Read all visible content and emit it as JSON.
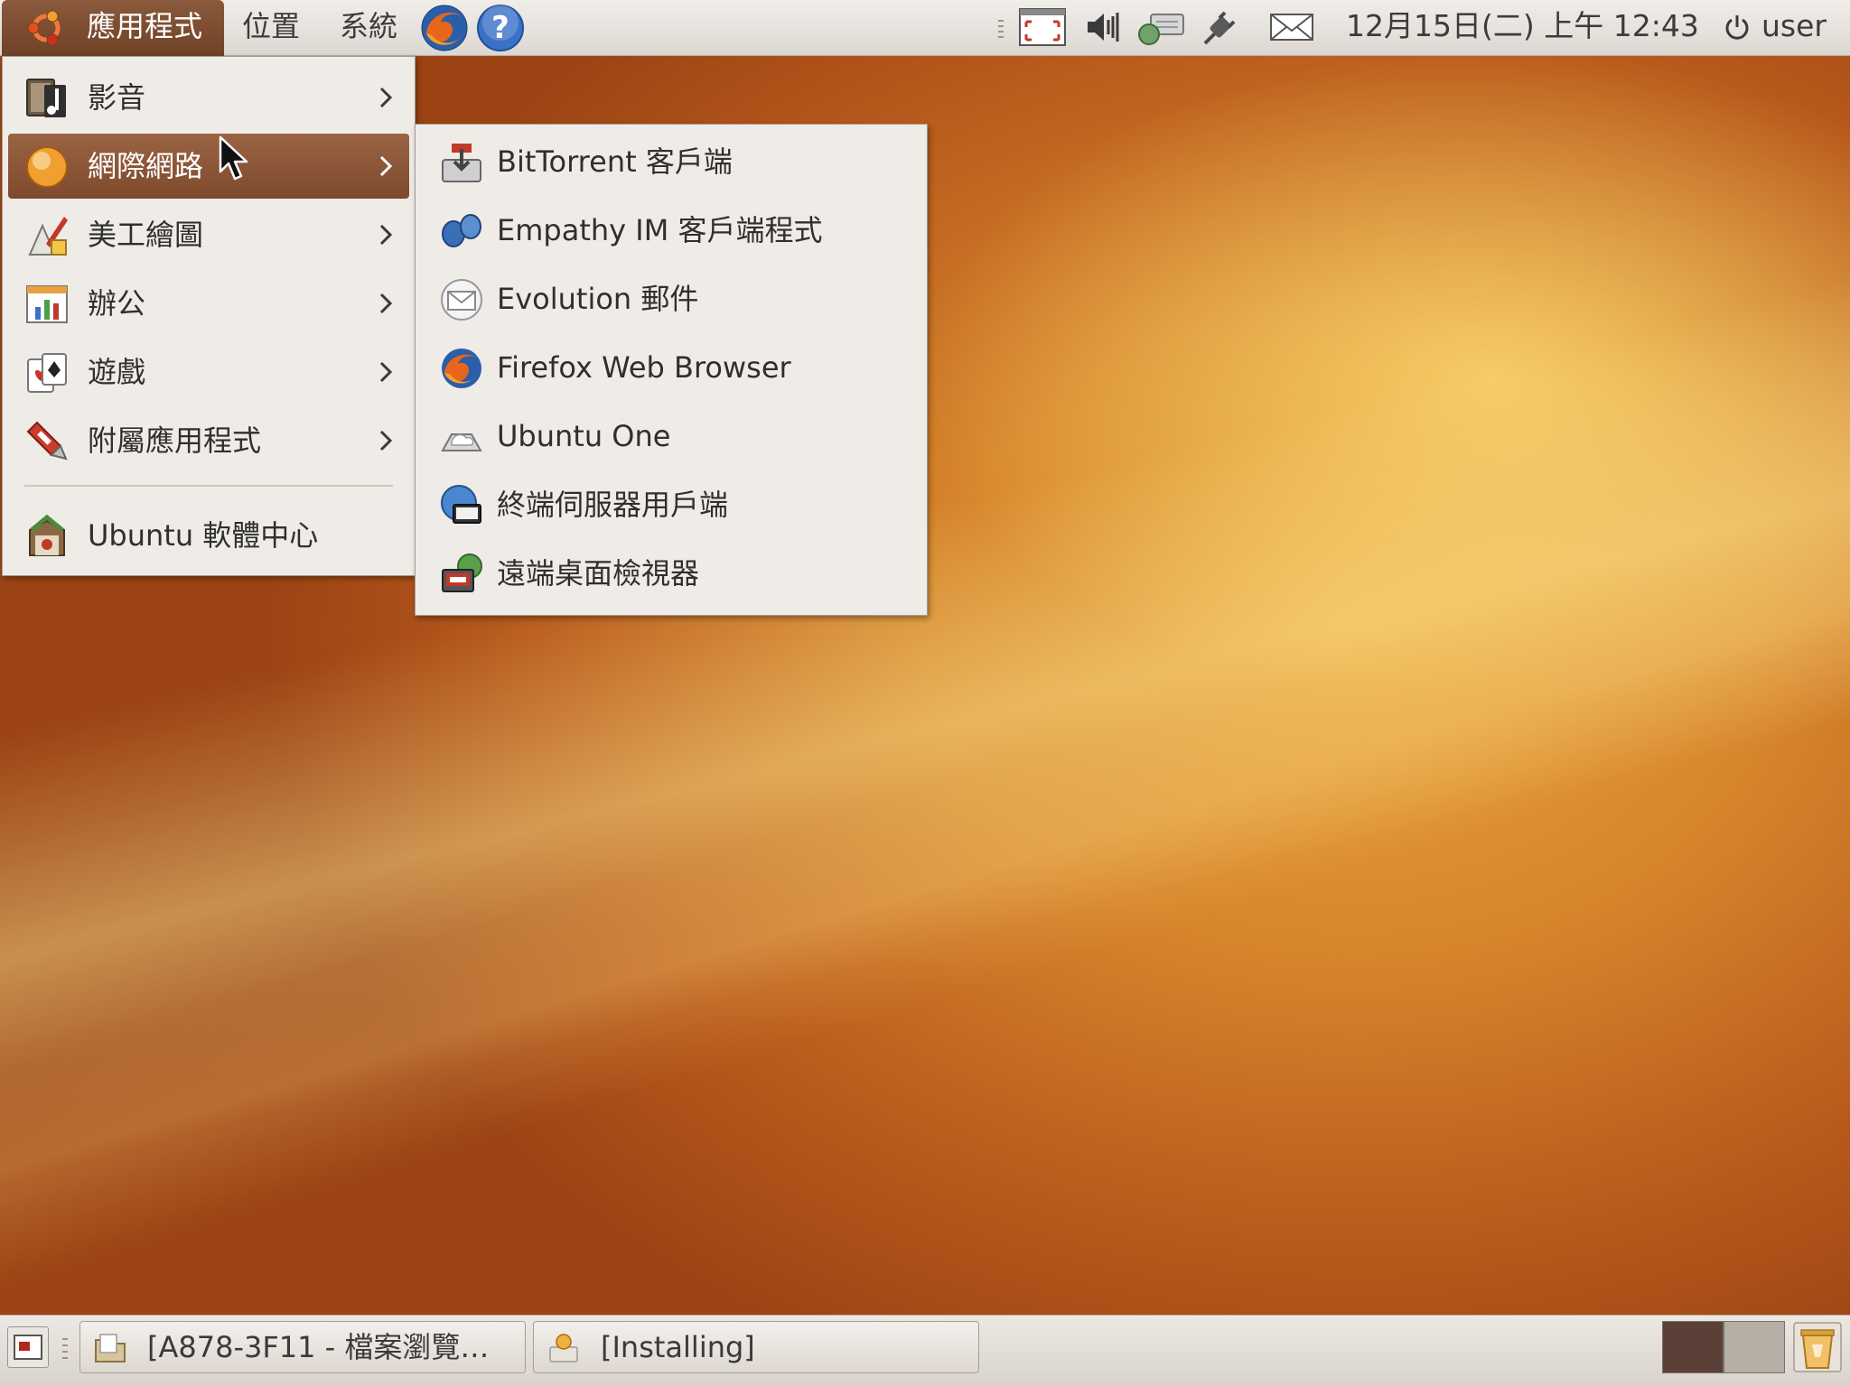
{
  "top_panel": {
    "menus": {
      "applications": "應用程式",
      "places": "位置",
      "system": "系統"
    },
    "launchers": [
      "firefox-icon",
      "help-icon"
    ],
    "tray_icons": [
      "screenshot-icon",
      "volume-icon",
      "network-icon",
      "power-plug-icon",
      "mail-icon"
    ],
    "clock": "12月15日(二) 上午 12:43",
    "user": "user"
  },
  "main_menu": {
    "items": [
      {
        "label": "影音",
        "icon": "sound-video-icon",
        "submenu": true
      },
      {
        "label": "網際網路",
        "icon": "internet-icon",
        "submenu": true,
        "highlighted": true
      },
      {
        "label": "美工繪圖",
        "icon": "graphics-icon",
        "submenu": true
      },
      {
        "label": "辦公",
        "icon": "office-icon",
        "submenu": true
      },
      {
        "label": "遊戲",
        "icon": "games-icon",
        "submenu": true
      },
      {
        "label": "附屬應用程式",
        "icon": "accessories-icon",
        "submenu": true
      }
    ],
    "software_center": {
      "label": "Ubuntu 軟體中心",
      "icon": "software-center-icon"
    }
  },
  "internet_submenu": {
    "items": [
      {
        "label": "BitTorrent 客戶端",
        "icon": "bittorrent-icon"
      },
      {
        "label": "Empathy IM 客戶端程式",
        "icon": "empathy-icon"
      },
      {
        "label": "Evolution 郵件",
        "icon": "evolution-mail-icon"
      },
      {
        "label": "Firefox Web Browser",
        "icon": "firefox-icon"
      },
      {
        "label": "Ubuntu One",
        "icon": "ubuntu-one-icon"
      },
      {
        "label": "終端伺服器用戶端",
        "icon": "terminal-server-client-icon"
      },
      {
        "label": "遠端桌面檢視器",
        "icon": "remote-desktop-viewer-icon"
      }
    ]
  },
  "bottom_panel": {
    "tasks": [
      {
        "label": "[A878-3F11 - 檔案瀏覽…",
        "icon": "folder-icon"
      },
      {
        "label": "[Installing]",
        "icon": "installer-icon"
      }
    ],
    "workspaces": 2,
    "active_workspace": 1
  },
  "colors": {
    "panel": "#e6e1dc",
    "menu_bg": "#efebe7",
    "highlight": "#8b5a3c",
    "desktop_orange": "#d6852b"
  }
}
